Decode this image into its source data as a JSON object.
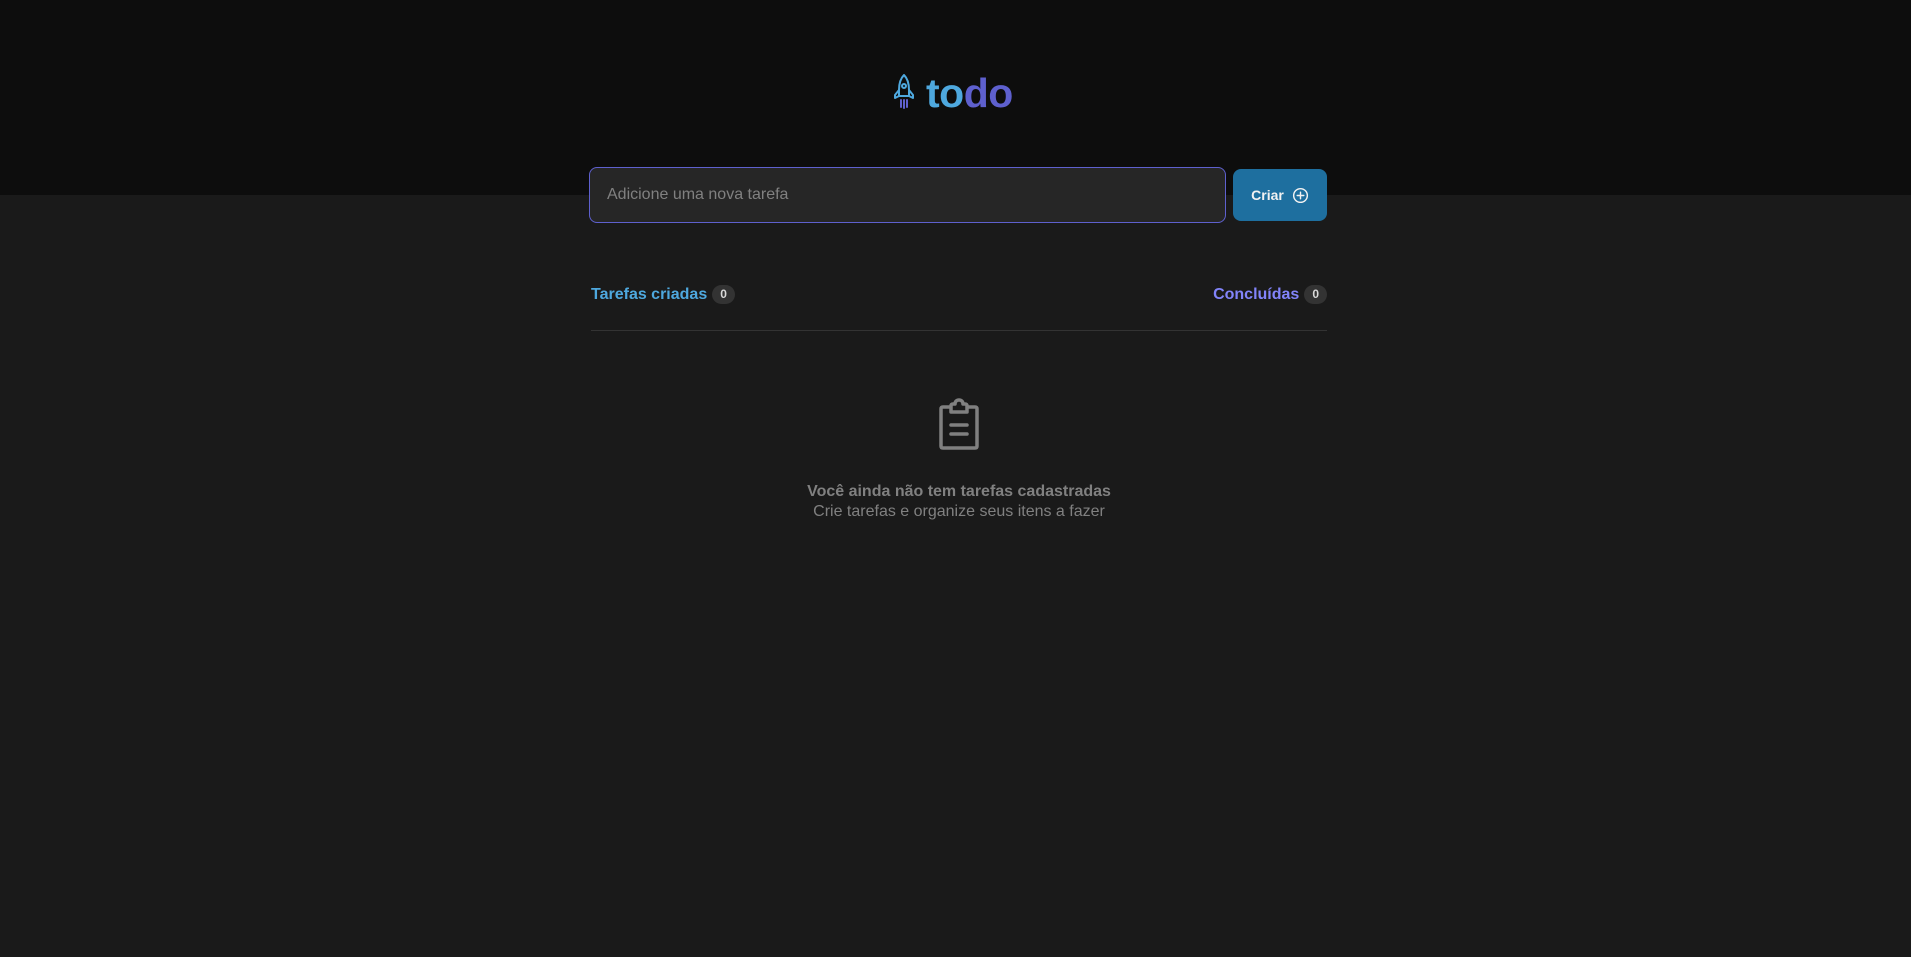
{
  "app": {
    "logo_part_1": "to",
    "logo_part_2": "do",
    "icon": "rocket-icon"
  },
  "new_task": {
    "placeholder": "Adicione uma nova tarefa",
    "value": "",
    "button_label": "Criar",
    "button_icon": "plus-circle-icon"
  },
  "counters": {
    "created_label": "Tarefas criadas",
    "created_count": "0",
    "done_label": "Concluídas",
    "done_count": "0"
  },
  "empty_state": {
    "icon": "clipboard-icon",
    "title": "Você ainda não tem tarefas cadastradas",
    "subtitle": "Crie tarefas e organize seus itens a fazer"
  },
  "colors": {
    "header_bg": "#0d0d0d",
    "body_bg": "#1a1a1a",
    "blue": "#4ea8de",
    "purple": "#5e60ce",
    "purple_light": "#8284fa",
    "button": "#1e6f9f",
    "muted": "#808080"
  }
}
